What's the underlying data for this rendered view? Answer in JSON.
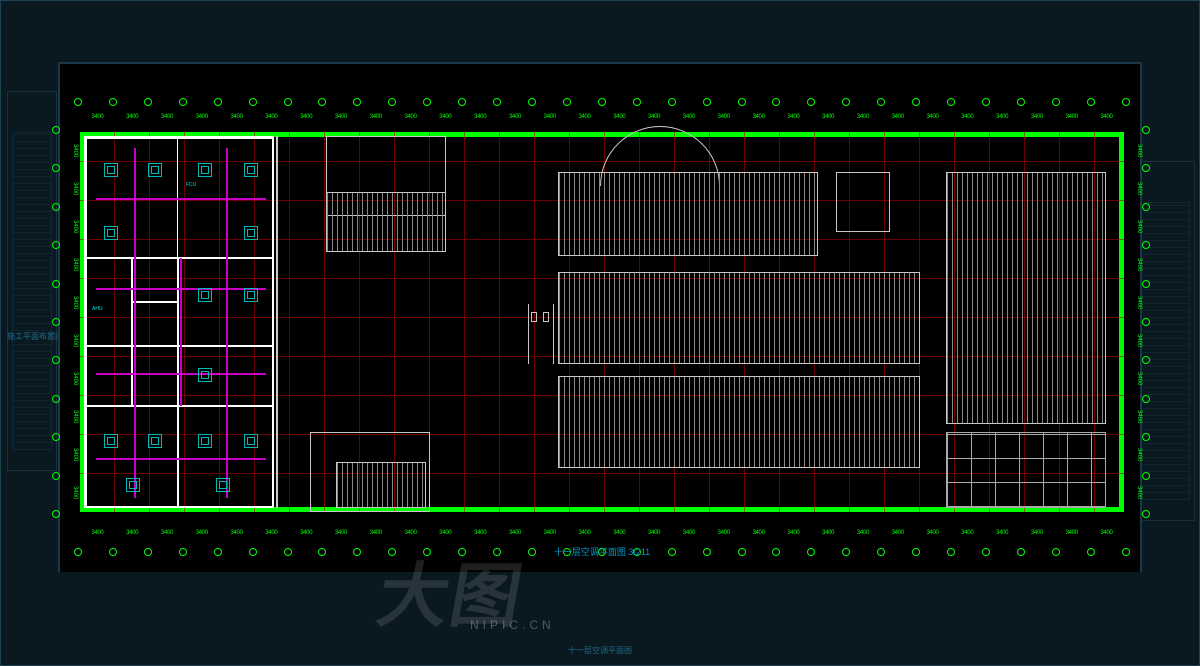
{
  "sheet_title": "十一层空调平面图 3/211",
  "bg_sheet_title": "十一层空调平面图",
  "watermark_large": "大图",
  "watermark_small": "NIPIC.CN",
  "side_label": "施工平面布置图",
  "grid": {
    "h_dim": "3400",
    "v_dim": "3400",
    "h_count": 30,
    "v_count": 10
  },
  "hvac": {
    "unit_label": "FCU",
    "core_label": "AHU"
  },
  "colors": {
    "grid_green": "#00ff00",
    "struct_red": "#b40000",
    "pipe_magenta": "#c800c8",
    "unit_cyan": "#00baba",
    "wall_white": "#ffffff"
  }
}
